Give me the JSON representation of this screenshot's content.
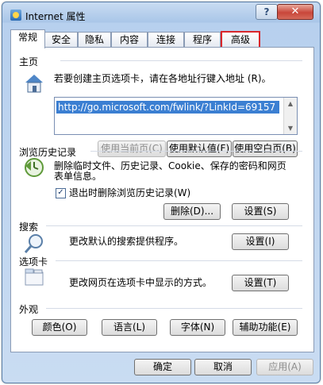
{
  "window": {
    "title": "Internet 属性",
    "help_glyph": "?",
    "close_glyph": "✕"
  },
  "tabs": [
    {
      "label": "常规"
    },
    {
      "label": "安全"
    },
    {
      "label": "隐私"
    },
    {
      "label": "内容"
    },
    {
      "label": "连接"
    },
    {
      "label": "程序"
    },
    {
      "label": "高级"
    }
  ],
  "homepage": {
    "section": "主页",
    "description": "若要创建主页选项卡，请在各地址行键入地址 (R)。",
    "url": "http://go.microsoft.com/fwlink/?LinkId=69157",
    "use_current": "使用当前页(C)",
    "use_default": "使用默认值(F)",
    "use_blank": "使用空白页(B)"
  },
  "history": {
    "section": "浏览历史记录",
    "description_line1": "删除临时文件、历史记录、Cookie、保存的密码和网页",
    "description_line2": "表单信息。",
    "checkbox_label": "退出时删除浏览历史记录(W)",
    "checkbox_mark": "✓",
    "delete_button": "删除(D)...",
    "settings_button": "设置(S)"
  },
  "search": {
    "section": "搜索",
    "description": "更改默认的搜索提供程序。",
    "settings_button": "设置(I)"
  },
  "tabs_section": {
    "section": "选项卡",
    "description": "更改网页在选项卡中显示的方式。",
    "settings_button": "设置(T)"
  },
  "appearance": {
    "section": "外观",
    "colors": "颜色(O)",
    "languages": "语言(L)",
    "fonts": "字体(N)",
    "accessibility": "辅助功能(E)"
  },
  "footer": {
    "ok": "确定",
    "cancel": "取消",
    "apply": "应用(A)"
  },
  "colors": {
    "selection": "#3b7fd2",
    "highlight_outline": "#d9262b"
  }
}
